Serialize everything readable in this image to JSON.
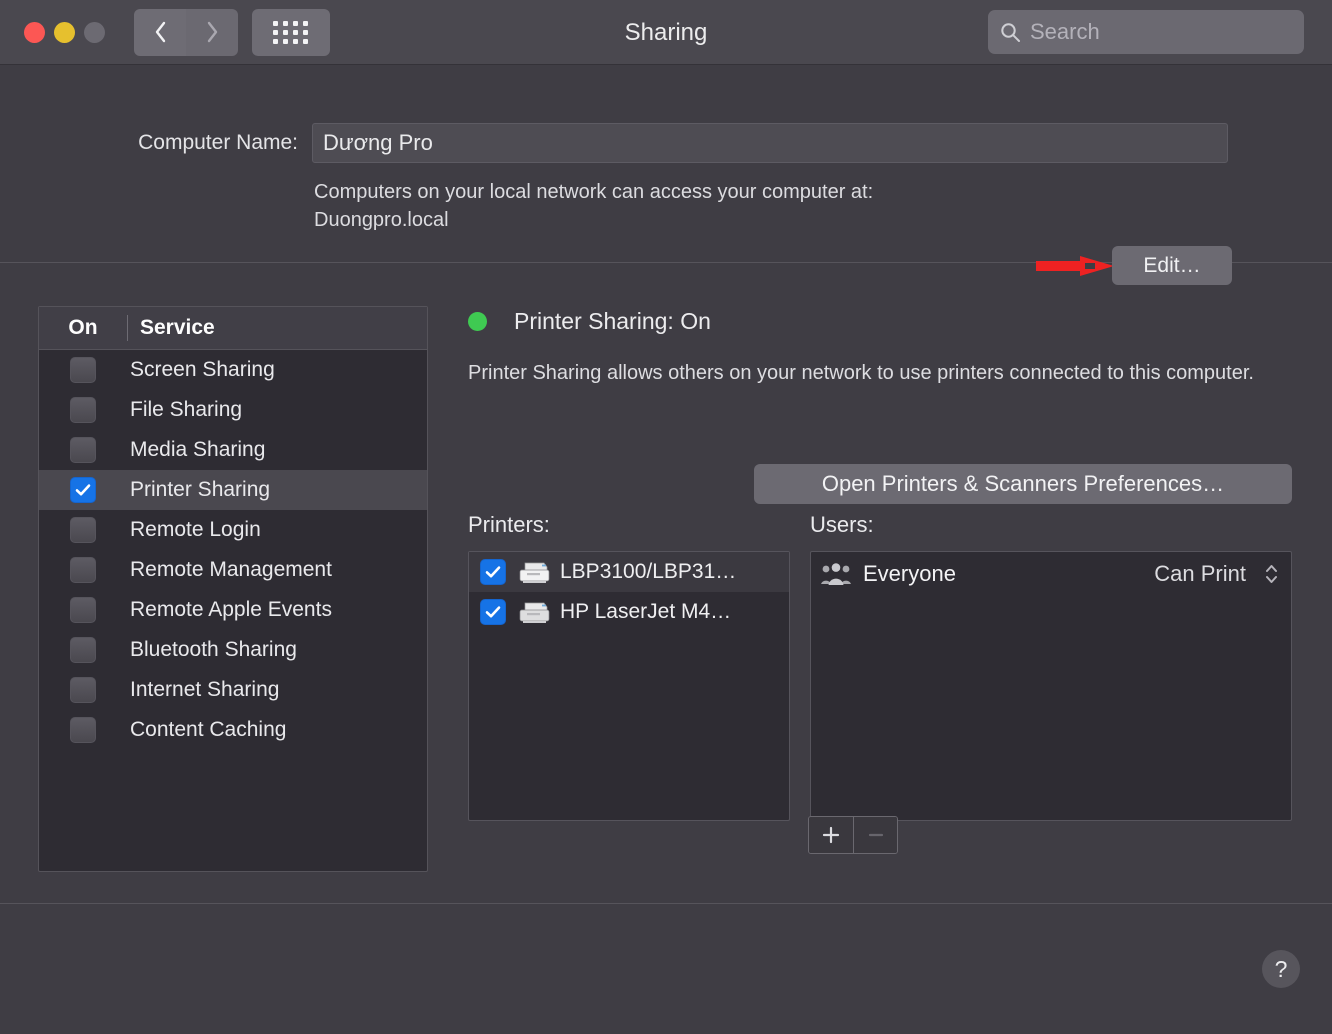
{
  "window": {
    "title": "Sharing",
    "traffic_lights": [
      "close-button",
      "minimize-button",
      "zoom-button"
    ],
    "nav": {
      "back": "back-icon",
      "forward": "forward-icon",
      "grid": "show-all-icon"
    },
    "search": {
      "placeholder": "Search",
      "value": ""
    }
  },
  "computer": {
    "name_label": "Computer Name:",
    "name_value": "Dương Pro",
    "access_text": "Computers on your local network can access your computer at:",
    "hostname": "Duongpro.local",
    "edit_button": "Edit…"
  },
  "services": {
    "header": {
      "on": "On",
      "service": "Service"
    },
    "items": [
      {
        "label": "Screen Sharing",
        "checked": false,
        "selected": false
      },
      {
        "label": "File Sharing",
        "checked": false,
        "selected": false
      },
      {
        "label": "Media Sharing",
        "checked": false,
        "selected": false
      },
      {
        "label": "Printer Sharing",
        "checked": true,
        "selected": true
      },
      {
        "label": "Remote Login",
        "checked": false,
        "selected": false
      },
      {
        "label": "Remote Management",
        "checked": false,
        "selected": false
      },
      {
        "label": "Remote Apple Events",
        "checked": false,
        "selected": false
      },
      {
        "label": "Bluetooth Sharing",
        "checked": false,
        "selected": false
      },
      {
        "label": "Internet Sharing",
        "checked": false,
        "selected": false
      },
      {
        "label": "Content Caching",
        "checked": false,
        "selected": false
      }
    ]
  },
  "detail": {
    "status": "Printer Sharing: On",
    "status_color": "#3fca52",
    "description": "Printer Sharing allows others on your network to use printers connected to this computer.",
    "open_prefs_button": "Open Printers & Scanners Preferences…",
    "printers_label": "Printers:",
    "printers": [
      {
        "name": "LBP3100/LBP31…",
        "checked": true
      },
      {
        "name": "HP LaserJet M4…",
        "checked": true
      }
    ],
    "users_label": "Users:",
    "users": [
      {
        "name": "Everyone",
        "permission": "Can Print"
      }
    ],
    "add_button": "+",
    "remove_button": "−"
  },
  "footer": {
    "help_button": "?"
  },
  "annotation": {
    "type": "red-arrow",
    "points_to": "edit-button",
    "color": "#ee2222"
  }
}
